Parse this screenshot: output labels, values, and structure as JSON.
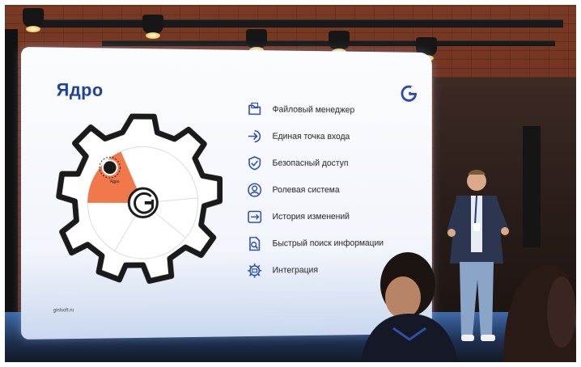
{
  "slide": {
    "title": "Ядро",
    "gear_label": "Ядро",
    "footer_url": "ginlsoft.ru",
    "features": [
      {
        "label": "Файловый менеджер",
        "icon": "folder-icon"
      },
      {
        "label": "Единая точка входа",
        "icon": "login-arrow-icon"
      },
      {
        "label": "Безопасный доступ",
        "icon": "shield-check-icon"
      },
      {
        "label": "Ролевая система",
        "icon": "user-icon"
      },
      {
        "label": "История изменений",
        "icon": "history-icon"
      },
      {
        "label": "Быстрый поиск информации",
        "icon": "document-search-icon"
      },
      {
        "label": "Интеграция",
        "icon": "integration-gear-icon"
      }
    ]
  },
  "colors": {
    "title_blue": "#1f3f9a",
    "gear_outline": "#1a1a1a",
    "sector_orange": "#f0784a",
    "icon_blue": "#2a4ca0"
  }
}
